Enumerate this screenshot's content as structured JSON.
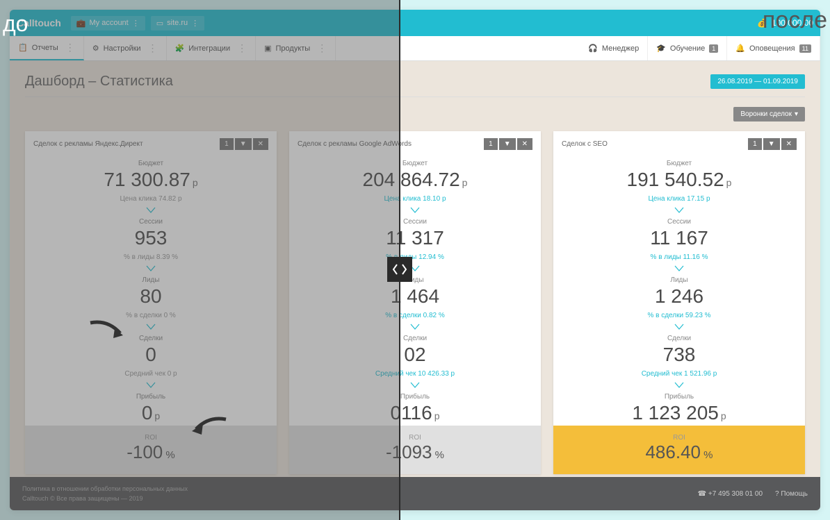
{
  "labels": {
    "before": "до",
    "after": "после"
  },
  "topbar": {
    "brand": "Calltouch",
    "account": "My account",
    "site": "site.ru",
    "balance": "100 000.00"
  },
  "menu": {
    "reports": "Отчеты",
    "settings": "Настройки",
    "integrations": "Интеграции",
    "products": "Продукты",
    "manager": "Менеджер",
    "training": "Обучение",
    "training_badge": "1",
    "alerts": "Оповещения",
    "alerts_badge": "11"
  },
  "page": {
    "title": "Дашборд – Статистика",
    "daterange": "26.08.2019 — 01.09.2019",
    "funnel_btn": "Воронки сделок"
  },
  "metric_labels": {
    "budget": "Бюджет",
    "cpc": "Цена клика",
    "sessions": "Сессии",
    "to_leads": "% в лиды",
    "leads": "Лиды",
    "to_deals": "% в сделки",
    "deals": "Сделки",
    "avg_check": "Средний чек",
    "profit": "Прибыль",
    "roi": "ROI"
  },
  "cards": [
    {
      "title": "Сделок с рекламы Яндекс.Директ",
      "badge_num": "1",
      "budget": "71 300.87",
      "cpc": "74.82 р",
      "sessions": "953",
      "to_leads": "8.39 %",
      "leads": "80",
      "to_deals": "0 %",
      "deals": "0",
      "avg_check": "0 р",
      "profit": "0",
      "roi": "-100"
    },
    {
      "title": "Сделок с рекламы Google AdWords",
      "badge_num": "1",
      "budget": "204 864.72",
      "cpc": "18.10 р",
      "sessions": "11 317",
      "to_leads": "12.94 %",
      "leads": "1 464",
      "to_deals": "0.82 %",
      "deals": "02",
      "avg_check": "10 426.33 р",
      "profit": "0116",
      "roi": "-1093"
    },
    {
      "title": "Сделок с SEO",
      "badge_num": "1",
      "budget": "191 540.52",
      "cpc": "17.15 р",
      "sessions": "11 167",
      "to_leads": "11.16 %",
      "leads": "1 246",
      "to_deals": "59.23 %",
      "deals": "738",
      "avg_check": "1 521.96 р",
      "profit": "1 123 205",
      "roi": "486.40"
    }
  ],
  "footer": {
    "privacy": "Политика в отношении обработки персональных данных",
    "copyright": "Calltouch © Все права защищены — 2019",
    "phone": "+7 495 308 01 00",
    "help": "Помощь"
  },
  "currency": "р",
  "percent": "%"
}
